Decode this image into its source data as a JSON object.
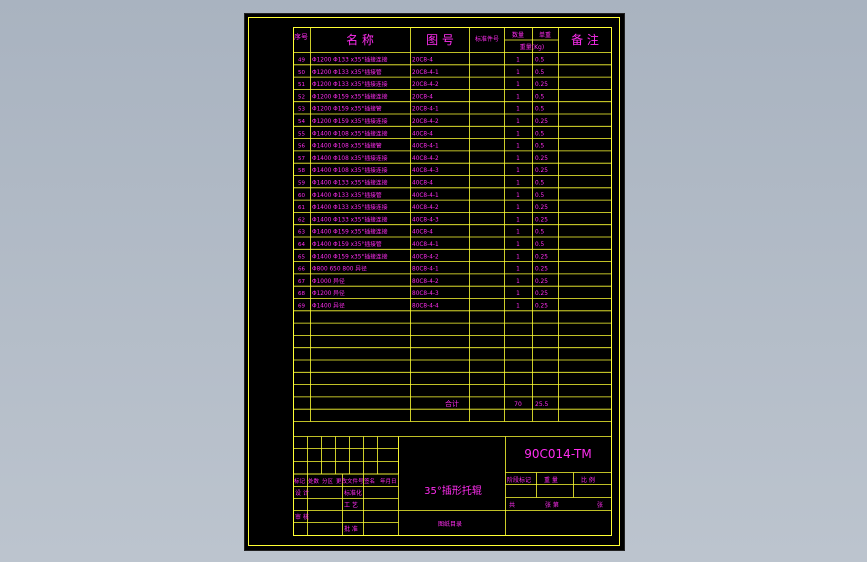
{
  "header": {
    "seq": "序号",
    "name": "名 称",
    "drawing": "图 号",
    "material_col": "标准件号",
    "qty_col": "数量",
    "unit_weight_col": "单重",
    "weight_col": "重量(Kg)",
    "remark": "备 注"
  },
  "rows": [
    {
      "no": "49",
      "name": "Φ1200 Φ133 x35°插接连接",
      "dwg": "20C8-4",
      "qty": "1",
      "wt": "0.5"
    },
    {
      "no": "50",
      "name": "Φ1200 Φ133 x35°插接管",
      "dwg": "20C8-4-1",
      "qty": "1",
      "wt": "0.5"
    },
    {
      "no": "51",
      "name": "Φ1200 Φ133 x35°插接连接",
      "dwg": "20C8-4-2",
      "qty": "1",
      "wt": "0.25"
    },
    {
      "no": "52",
      "name": "Φ1200 Φ159 x35°插接连接",
      "dwg": "20C8-4",
      "qty": "1",
      "wt": "0.5"
    },
    {
      "no": "53",
      "name": "Φ1200 Φ159 x35°插接管",
      "dwg": "20C8-4-1",
      "qty": "1",
      "wt": "0.5"
    },
    {
      "no": "54",
      "name": "Φ1200 Φ159 x35°插接连接",
      "dwg": "20C8-4-2",
      "qty": "1",
      "wt": "0.25"
    },
    {
      "no": "55",
      "name": "Φ1400 Φ108 x35°插接连接",
      "dwg": "40C8-4",
      "qty": "1",
      "wt": "0.5"
    },
    {
      "no": "56",
      "name": "Φ1400 Φ108 x35°插接管",
      "dwg": "40C8-4-1",
      "qty": "1",
      "wt": "0.5"
    },
    {
      "no": "57",
      "name": "Φ1400 Φ108 x35°插接连接",
      "dwg": "40C8-4-2",
      "qty": "1",
      "wt": "0.25"
    },
    {
      "no": "58",
      "name": "Φ1400 Φ108 x35°插接连接",
      "dwg": "40C8-4-3",
      "qty": "1",
      "wt": "0.25"
    },
    {
      "no": "59",
      "name": "Φ1400 Φ133 x35°插接连接",
      "dwg": "40C8-4",
      "qty": "1",
      "wt": "0.5"
    },
    {
      "no": "60",
      "name": "Φ1400 Φ133 x35°插接管",
      "dwg": "40C8-4-1",
      "qty": "1",
      "wt": "0.5"
    },
    {
      "no": "61",
      "name": "Φ1400 Φ133 x35°插接连接",
      "dwg": "40C8-4-2",
      "qty": "1",
      "wt": "0.25"
    },
    {
      "no": "62",
      "name": "Φ1400 Φ133 x35°插接连接",
      "dwg": "40C8-4-3",
      "qty": "1",
      "wt": "0.25"
    },
    {
      "no": "63",
      "name": "Φ1400 Φ159 x35°插接连接",
      "dwg": "40C8-4",
      "qty": "1",
      "wt": "0.5"
    },
    {
      "no": "64",
      "name": "Φ1400 Φ159 x35°插接管",
      "dwg": "40C8-4-1",
      "qty": "1",
      "wt": "0.5"
    },
    {
      "no": "65",
      "name": "Φ1400 Φ159 x35°插接连接",
      "dwg": "40C8-4-2",
      "qty": "1",
      "wt": "0.25"
    },
    {
      "no": "66",
      "name": "Φ800 650 800 异径",
      "dwg": "80C8-4-1",
      "qty": "1",
      "wt": "0.25"
    },
    {
      "no": "67",
      "name": "Φ1000 异径",
      "dwg": "80C8-4-2",
      "qty": "1",
      "wt": "0.25"
    },
    {
      "no": "68",
      "name": "Φ1200 异径",
      "dwg": "80C8-4-3",
      "qty": "1",
      "wt": "0.25"
    },
    {
      "no": "69",
      "name": "Φ1400 异径",
      "dwg": "80C8-4-4",
      "qty": "1",
      "wt": "0.25"
    }
  ],
  "total": {
    "label": "合计",
    "qty": "70",
    "weight": "25.5"
  },
  "title_block": {
    "code": "90C014-TM",
    "title": "35°插形托辊",
    "stage_label": "阶段标记",
    "weight_label": "重 量",
    "scale_label": "比 例",
    "sheet_total": "共",
    "sheet_of": "张 第",
    "sheet_unit": "张",
    "doc_type": "图纸目录",
    "rev_row": [
      "标记",
      "处数",
      "分区",
      "更改文件号",
      "签名",
      "年月日"
    ],
    "design": "设 计",
    "std": "标准化",
    "review": "审 核",
    "craft": "工 艺",
    "approve": "批 准"
  }
}
